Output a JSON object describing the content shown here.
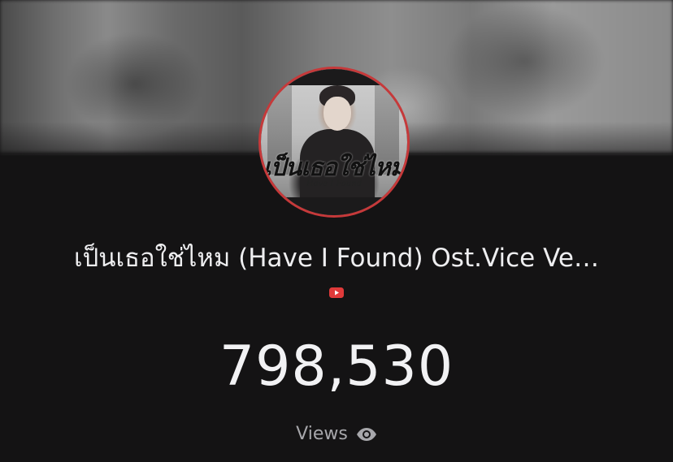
{
  "avatar": {
    "title": "เป็นเธอใช่ไหม",
    "subtitle": "Have I Found",
    "ring_color": "#c6393a"
  },
  "video": {
    "title": "เป็นเธอใช่ไหม (Have I Found) Ost.Vice Ve…",
    "platform_icon": "youtube-icon",
    "platform_color": "#e03a3a"
  },
  "stats": {
    "count": "798,530",
    "label": "Views",
    "label_icon": "eye-icon"
  }
}
